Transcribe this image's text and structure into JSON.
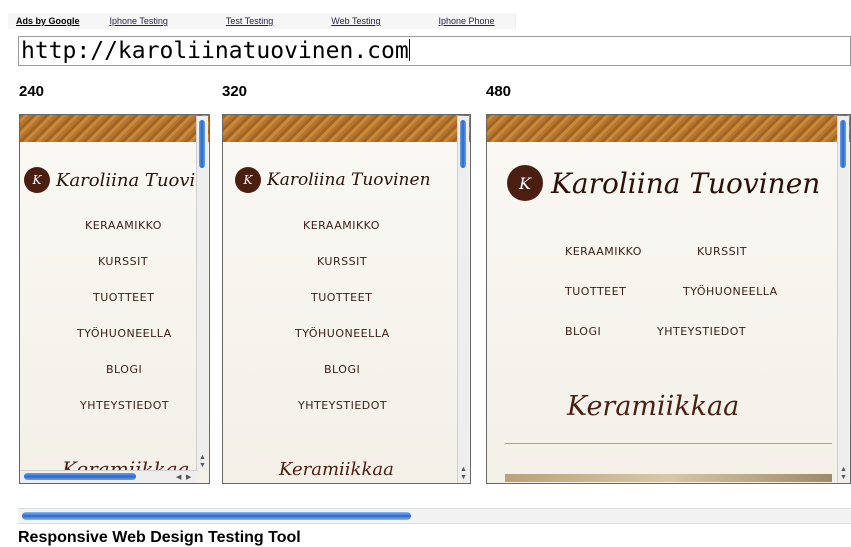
{
  "ads": {
    "brand": "Ads by Google",
    "links": [
      "Iphone Testing",
      "Test Testing",
      "Web Testing",
      "Iphone Phone"
    ]
  },
  "url_input": {
    "value": "http://karoliinatuovinen.com"
  },
  "viewports": [
    {
      "width_label": "240",
      "logo_mark": "K",
      "logo_text": "Karoliina Tuovin",
      "menu": [
        "KERAAMIKKO",
        "KURSSIT",
        "TUOTTEET",
        "TYÖHUONEELLA",
        "BLOGI",
        "YHTEYSTIEDOT"
      ],
      "heading": "Keramiikkaa"
    },
    {
      "width_label": "320",
      "logo_mark": "K",
      "logo_text": "Karoliina Tuovinen",
      "menu": [
        "KERAAMIKKO",
        "KURSSIT",
        "TUOTTEET",
        "TYÖHUONEELLA",
        "BLOGI",
        "YHTEYSTIEDOT"
      ],
      "heading": "Keramiikkaa"
    },
    {
      "width_label": "480",
      "logo_mark": "K",
      "logo_text": "Karoliina Tuovinen",
      "menu": [
        "KERAAMIKKO",
        "KURSSIT",
        "TUOTTEET",
        "TYÖHUONEELLA",
        "BLOGI",
        "YHTEYSTIEDOT"
      ],
      "heading": "Keramiikkaa"
    }
  ],
  "footer": {
    "title": "Responsive Web Design Testing Tool"
  },
  "colors": {
    "scroll_thumb": "#2a68c8",
    "brand_brown": "#4a1f12",
    "texture": "#b57530"
  }
}
